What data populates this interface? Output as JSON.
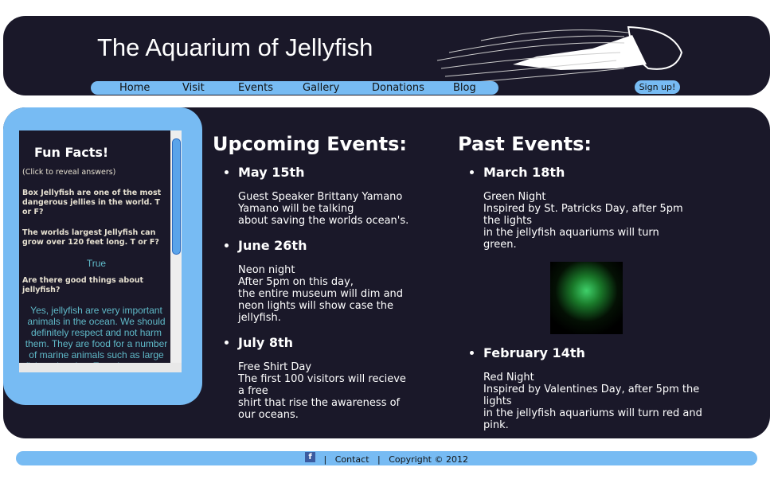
{
  "header": {
    "title": "The Aquarium of Jellyfish",
    "nav": [
      "Home",
      "Visit",
      "Events",
      "Gallery",
      "Donations",
      "Blog"
    ],
    "signup": "Sign up!"
  },
  "fun_facts": {
    "title": "Fun Facts!",
    "hint": "(Click to reveal answers)",
    "q1": "Box Jellyfish are one of the most dangerous jellies in the world. T or F?",
    "q2": "The worlds largest Jellyfish can grow over 120 feet long. T or F?",
    "a2": "True",
    "q3": "Are there good things about jellyfish?",
    "a3": "Yes, jellyfish are very important animals in the ocean. We should definitely respect and not harm them. They are food for a number of marine animals such as large fish and turtles. Even humans eat"
  },
  "upcoming": {
    "title": "Upcoming Events:",
    "events": [
      {
        "date": "May 15th",
        "desc": "Guest Speaker Brittany Yamano\n    Yamano will be talking\nabout saving the worlds ocean's."
      },
      {
        "date": "June 26th",
        "desc": "Neon night\n    After 5pm on this day,\nthe entire museum will dim and neon lights will show case the jellyfish."
      },
      {
        "date": "July 8th",
        "desc": "Free Shirt Day\n    The first 100 visitors will recieve a free\nshirt that rise the awareness of our oceans."
      }
    ]
  },
  "past": {
    "title": "Past Events:",
    "events": [
      {
        "date": "March 18th",
        "desc": "Green Night\n  Inspired by St. Patricks Day, after 5pm the lights\nin the jellyfish aquariums will turn green."
      },
      {
        "date": "February 14th",
        "desc": "Red Night\n  Inspired by Valentines Day, after 5pm the lights\nin the jellyfish aquariums will turn red and pink."
      }
    ]
  },
  "footer": {
    "facebook": "f",
    "sep": "|",
    "contact": "Contact",
    "copyright": "Copyright © 2012"
  },
  "colors": {
    "dark": "#1a1829",
    "accent": "#77bbf3"
  }
}
